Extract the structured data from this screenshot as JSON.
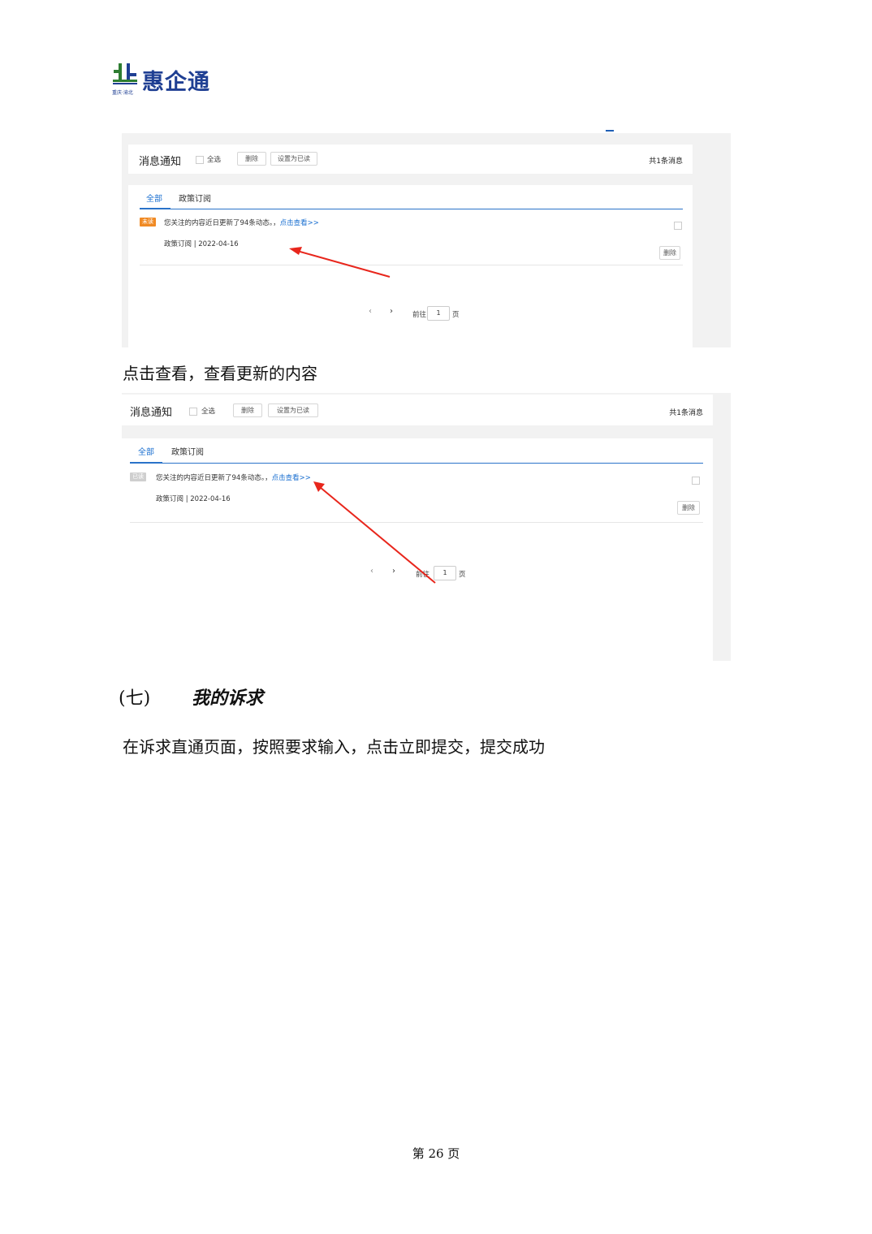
{
  "header": {
    "logo_text": "惠企通",
    "logo_sub": "重庆·渝北"
  },
  "screenshot1": {
    "title": "消息通知",
    "select_all": "全选",
    "delete_btn": "删除",
    "mark_read_btn": "设置为已读",
    "count": "共1条消息",
    "tabs": [
      "全部",
      "政策订阅"
    ],
    "badge": "未读",
    "message": "您关注的内容近日更新了94条动态。，",
    "link": "点击查看>>",
    "meta": "政策订阅  |  2022-04-16",
    "row_delete": "删除",
    "pager_prefix": "前往",
    "pager_page": "1",
    "pager_suffix": "页"
  },
  "caption1": "点击查看，查看更新的内容",
  "screenshot2": {
    "title": "消息通知",
    "select_all": "全选",
    "delete_btn": "删除",
    "mark_read_btn": "设置为已读",
    "count": "共1条消息",
    "tabs": [
      "全部",
      "政策订阅"
    ],
    "badge": "已读",
    "message": "您关注的内容近日更新了94条动态。，",
    "link": "点击查看>>",
    "meta": "政策订阅  |  2022-04-16",
    "row_delete": "删除",
    "pager_prefix": "前往",
    "pager_page": "1",
    "pager_suffix": "页"
  },
  "section": {
    "number": "(七)",
    "title": "我的诉求"
  },
  "paragraph": "在诉求直通页面，按照要求输入，点击立即提交，提交成功",
  "footer": "第 26 页",
  "colors": {
    "brand_blue": "#1f3f93",
    "link_blue": "#1a6fd0",
    "unread_orange": "#f08a24",
    "read_gray": "#cfcfcf",
    "arrow_red": "#e8261c"
  }
}
